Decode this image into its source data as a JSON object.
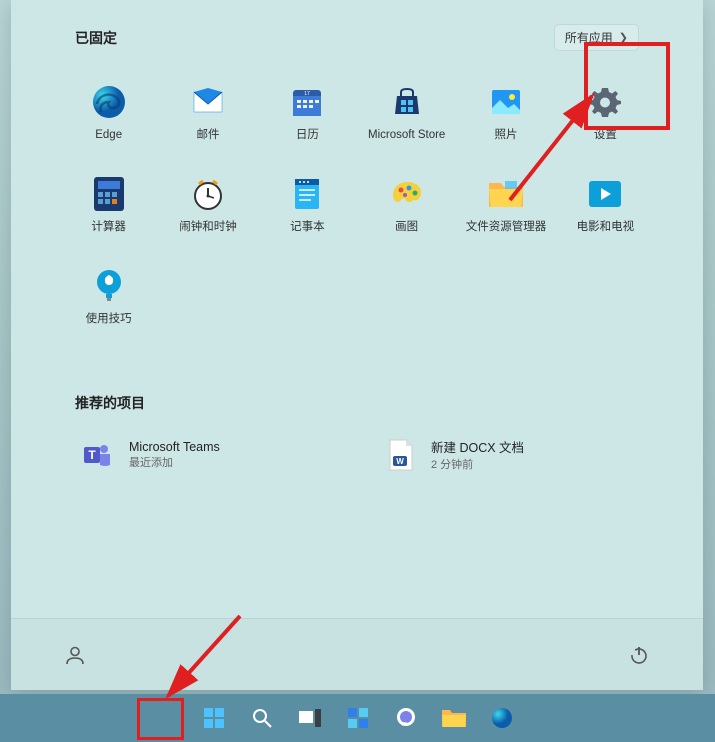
{
  "pinned": {
    "title": "已固定",
    "all_apps": "所有应用",
    "items": [
      {
        "label": "Edge",
        "icon": "edge"
      },
      {
        "label": "邮件",
        "icon": "mail"
      },
      {
        "label": "日历",
        "icon": "calendar"
      },
      {
        "label": "Microsoft Store",
        "icon": "store"
      },
      {
        "label": "照片",
        "icon": "photos"
      },
      {
        "label": "设置",
        "icon": "settings"
      },
      {
        "label": "计算器",
        "icon": "calculator"
      },
      {
        "label": "闹钟和时钟",
        "icon": "clock"
      },
      {
        "label": "记事本",
        "icon": "notepad"
      },
      {
        "label": "画图",
        "icon": "paint"
      },
      {
        "label": "文件资源管理器",
        "icon": "explorer"
      },
      {
        "label": "电影和电视",
        "icon": "movies"
      },
      {
        "label": "使用技巧",
        "icon": "tips"
      }
    ]
  },
  "recommended": {
    "title": "推荐的项目",
    "items": [
      {
        "title": "Microsoft Teams",
        "sub": "最近添加",
        "icon": "teams"
      },
      {
        "title": "新建 DOCX 文档",
        "sub": "2 分钟前",
        "icon": "docx"
      }
    ]
  }
}
